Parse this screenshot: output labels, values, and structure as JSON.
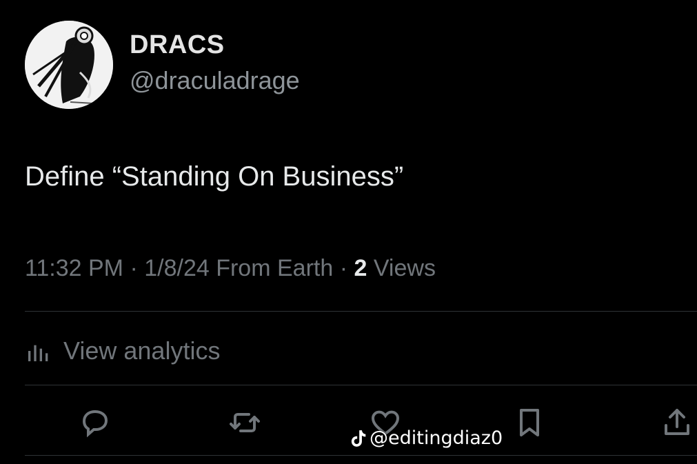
{
  "author": {
    "display_name": "DRACS",
    "handle": "@draculadrage"
  },
  "tweet": {
    "text": "Define “Standing On Business”",
    "time": "11:32 PM",
    "date": "1/8/24",
    "source": "From Earth",
    "views_count": "2",
    "views_label": "Views"
  },
  "analytics": {
    "label": "View analytics"
  },
  "actions": [
    "reply-icon",
    "retweet-icon",
    "like-icon",
    "bookmark-icon",
    "share-icon"
  ],
  "watermark": {
    "text": "@editingdiaz0"
  },
  "colors": {
    "background": "#000000",
    "primary_text": "#e7e9ea",
    "secondary_text": "#71767b",
    "divider": "#2f3336"
  }
}
